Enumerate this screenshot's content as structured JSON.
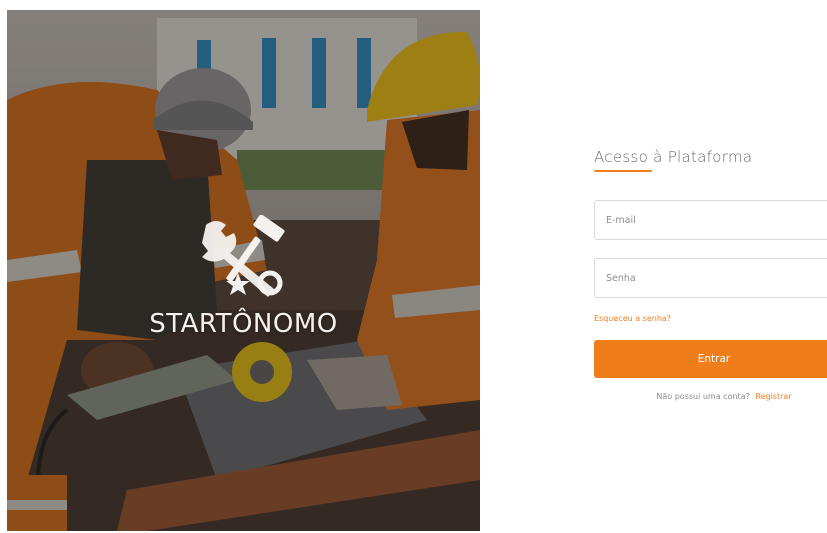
{
  "hero": {
    "brand_name": "STARTÔNOMO",
    "logo_icon": "tools-star-icon",
    "image_description_icon": "workers-photo"
  },
  "login": {
    "title": "Acesso à Plataforma",
    "email_placeholder": "E-mail",
    "password_placeholder": "Senha",
    "forgot_link": "Esqueceu a senha?",
    "submit_label": "Entrar",
    "no_account_text": "Não possui uma conta?",
    "register_link": "Registrar"
  },
  "colors": {
    "accent": "#ef7d1a",
    "text_muted": "#8a8a8a",
    "border": "#d9d9d9"
  }
}
